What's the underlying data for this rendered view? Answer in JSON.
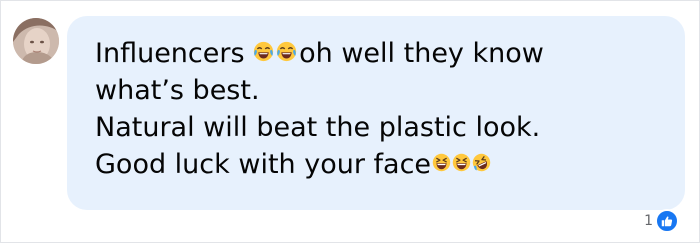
{
  "comment": {
    "text_line1_start": "Influencers ",
    "text_line1_end": "oh well they know",
    "text_line2": "what’s best.",
    "text_line3": "Natural will beat the plastic look.",
    "text_line4": "Good luck with your face",
    "emojis_line1": [
      "joy-emoji",
      "joy-emoji"
    ],
    "emojis_line4": [
      "grinning-squinting-emoji",
      "grinning-squinting-emoji",
      "rofl-emoji"
    ]
  },
  "reactions": {
    "count": "1",
    "icon": "like-thumb-icon"
  },
  "colors": {
    "bubble": "#e7f1fd",
    "text": "#050505",
    "like_blue": "#1877f2",
    "meta_gray": "#65676b",
    "emoji_yellow": "#ffc83d",
    "tear_blue": "#4aa8e6"
  }
}
